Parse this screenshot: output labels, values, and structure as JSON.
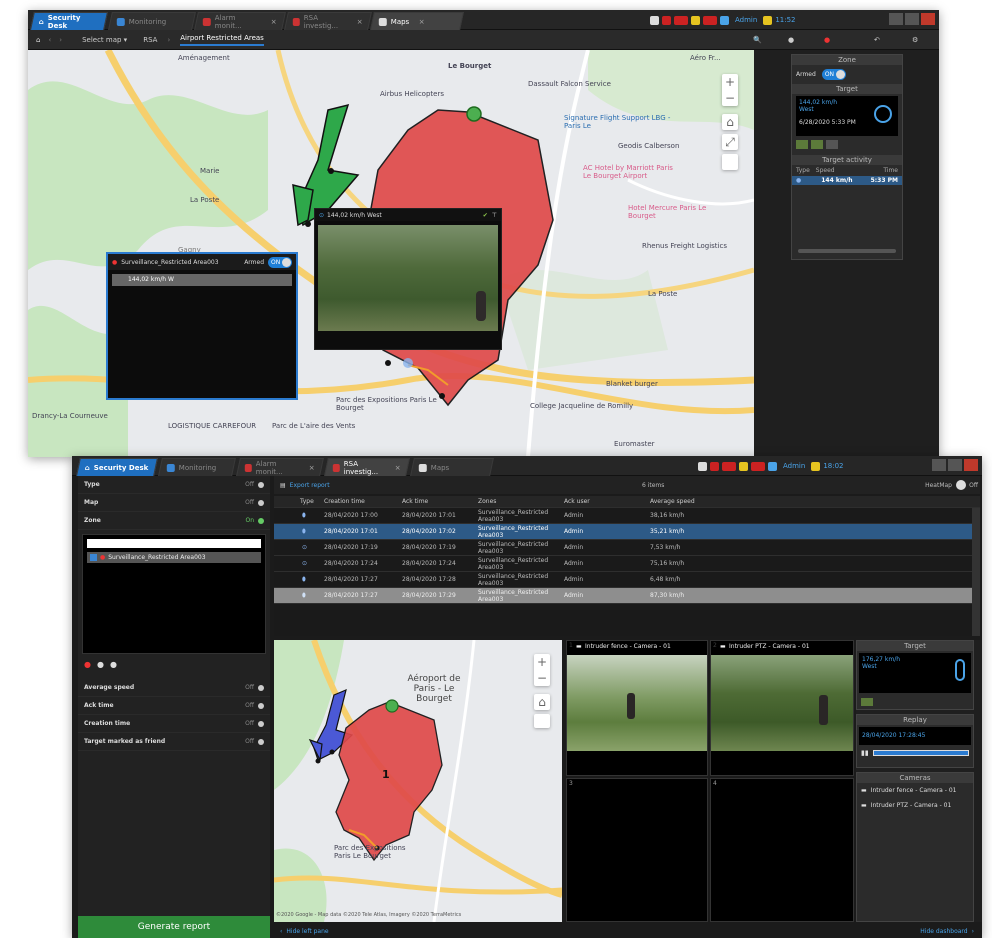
{
  "top": {
    "tabs": [
      {
        "label": "Security Desk"
      },
      {
        "label": "Monitoring"
      },
      {
        "label": "Alarm monit..."
      },
      {
        "label": "RSA investig..."
      },
      {
        "label": "Maps"
      }
    ],
    "clock": "11:52",
    "user_label": "Admin",
    "toolbar": {
      "select_map": "Select map",
      "crumb1": "RSA",
      "crumb2": "Airport Restricted Areas"
    },
    "map_labels": [
      "Aménagement",
      "Airbus Helicopters",
      "Dassault Falcon Service",
      "Signature Flight Support LBG - Paris Le",
      "Geodis Calberson",
      "Marie",
      "La Poste",
      "AC Hotel by Marriott Paris Le Bourget Airport",
      "Hotel Mercure Paris Le Bourget",
      "Rhenus Freight Logistics",
      "La Poste",
      "Parc des Expositions Paris Le Bourget",
      "Drancy-La Courneuve",
      "LOGISTIQUE CARREFOUR",
      "Parc de L'aire des Vents",
      "Blanket burger",
      "College Jacqueline de Romilly",
      "Euromaster",
      "Le Bourget",
      "Gagny",
      "Aéro Fr..."
    ],
    "video_popup": {
      "title": "144,02 km/h West"
    },
    "zone_popup": {
      "title": "Surveillance_Restricted Area003",
      "armed_label": "Armed",
      "toggle": "ON",
      "speed": "144,02 km/h W"
    },
    "zone_panel": {
      "title": "Zone",
      "armed_label": "Armed",
      "toggle": "ON",
      "target_label": "Target",
      "target_speed": "144,02 km/h",
      "target_dir": "West",
      "target_time": "6/28/2020 5:33 PM",
      "activity_label": "Target activity",
      "col_type": "Type",
      "col_speed": "Speed",
      "col_time": "Time",
      "act_speed": "144 km/h",
      "act_time": "5:33 PM"
    }
  },
  "bottom": {
    "tabs": [
      {
        "label": "Security Desk"
      },
      {
        "label": "Monitoring"
      },
      {
        "label": "Alarm monit..."
      },
      {
        "label": "RSA investig..."
      },
      {
        "label": "Maps"
      }
    ],
    "clock": "18:02",
    "filters": [
      {
        "label": "Type",
        "state": "Off"
      },
      {
        "label": "Map",
        "state": "Off"
      },
      {
        "label": "Zone",
        "state": "On"
      }
    ],
    "zone_item": "Surveillance_Restricted Area003",
    "filters2": [
      {
        "label": "Average speed",
        "state": "Off"
      },
      {
        "label": "Ack time",
        "state": "Off"
      },
      {
        "label": "Creation time",
        "state": "Off"
      },
      {
        "label": "Target marked as friend",
        "state": "Off"
      }
    ],
    "generate_button": "Generate report",
    "export_label": "Export report",
    "items_count": "6 items",
    "heatmap_label": "HeatMap",
    "heatmap_state": "Off",
    "columns": [
      "Type",
      "Creation time",
      "Ack time",
      "Zones",
      "Ack user",
      "Average speed"
    ],
    "rows": [
      [
        "28/04/2020 17:00",
        "28/04/2020 17:01",
        "Surveillance_Restricted Area003",
        "Admin",
        "38,16 km/h"
      ],
      [
        "28/04/2020 17:01",
        "28/04/2020 17:02",
        "Surveillance_Restricted Area003",
        "Admin",
        "35,21 km/h"
      ],
      [
        "28/04/2020 17:19",
        "28/04/2020 17:19",
        "Surveillance_Restricted Area003",
        "Admin",
        "7,53 km/h"
      ],
      [
        "28/04/2020 17:24",
        "28/04/2020 17:24",
        "Surveillance_Restricted Area003",
        "Admin",
        "75,16 km/h"
      ],
      [
        "28/04/2020 17:27",
        "28/04/2020 17:28",
        "Surveillance_Restricted Area003",
        "Admin",
        "6,48 km/h"
      ],
      [
        "28/04/2020 17:27",
        "28/04/2020 17:29",
        "Surveillance_Restricted Area003",
        "Admin",
        "87,30 km/h"
      ]
    ],
    "map_title": "Aéroport de Paris - Le Bourget",
    "map_zone_number": "1",
    "map_labels": [
      "Parc des Expositions Paris Le Bourget"
    ],
    "map_attrib": "©2020 Google - Map data ©2020 Tele Atlas, Imagery ©2020 TerraMetrics",
    "cameras": [
      {
        "num": "1",
        "title": "Intruder fence - Camera - 01"
      },
      {
        "num": "2",
        "title": "Intruder PTZ - Camera - 01"
      },
      {
        "num": "3",
        "title": ""
      },
      {
        "num": "4",
        "title": ""
      }
    ],
    "target_panel": {
      "title": "Target",
      "speed": "176,27 km/h",
      "dir": "West"
    },
    "replay_panel": {
      "title": "Replay",
      "time": "28/04/2020 17:28:45"
    },
    "cameras_panel": {
      "title": "Cameras",
      "items": [
        "Intruder fence - Camera - 01",
        "Intruder PTZ - Camera - 01"
      ]
    },
    "hide_left": "Hide left pane",
    "hide_dash": "Hide dashboard"
  }
}
